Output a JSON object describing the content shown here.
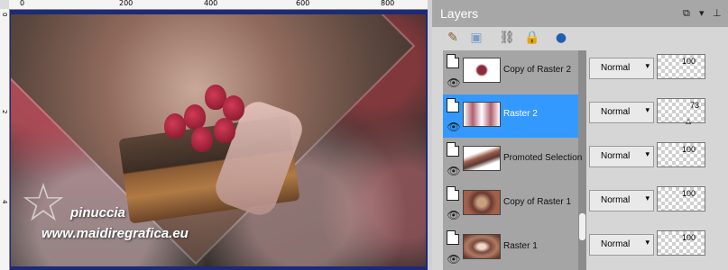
{
  "rulers": {
    "horizontal": [
      "0",
      "200",
      "400",
      "600",
      "800"
    ],
    "vertical": [
      "0",
      "2",
      "4"
    ]
  },
  "watermark": {
    "name": "pinuccia",
    "url": "www.maidiregrafica.eu"
  },
  "layers_panel": {
    "title": "Layers",
    "header_icons": [
      "restore-icon",
      "dropdown-arrow-icon",
      "pin-icon"
    ],
    "toolbar_icons": [
      "layer-properties-icon",
      "group-icon",
      "link-icon",
      "lock-icon",
      "mask-icon"
    ],
    "layers": [
      {
        "name": "Copy of Raster 2",
        "blend": "Normal",
        "opacity": "100",
        "selected": false
      },
      {
        "name": "Raster 2",
        "blend": "Normal",
        "opacity": "73",
        "selected": true
      },
      {
        "name": "Promoted Selection",
        "blend": "Normal",
        "opacity": "100",
        "selected": false
      },
      {
        "name": "Copy of Raster 1",
        "blend": "Normal",
        "opacity": "100",
        "selected": false
      },
      {
        "name": "Raster 1",
        "blend": "Normal",
        "opacity": "100",
        "selected": false
      }
    ]
  },
  "colors": {
    "selection": "#3399ff",
    "panel_header": "#a7a7a7",
    "panel_bg": "#d6d6d6",
    "layer_list_bg": "#a5a5a5"
  }
}
